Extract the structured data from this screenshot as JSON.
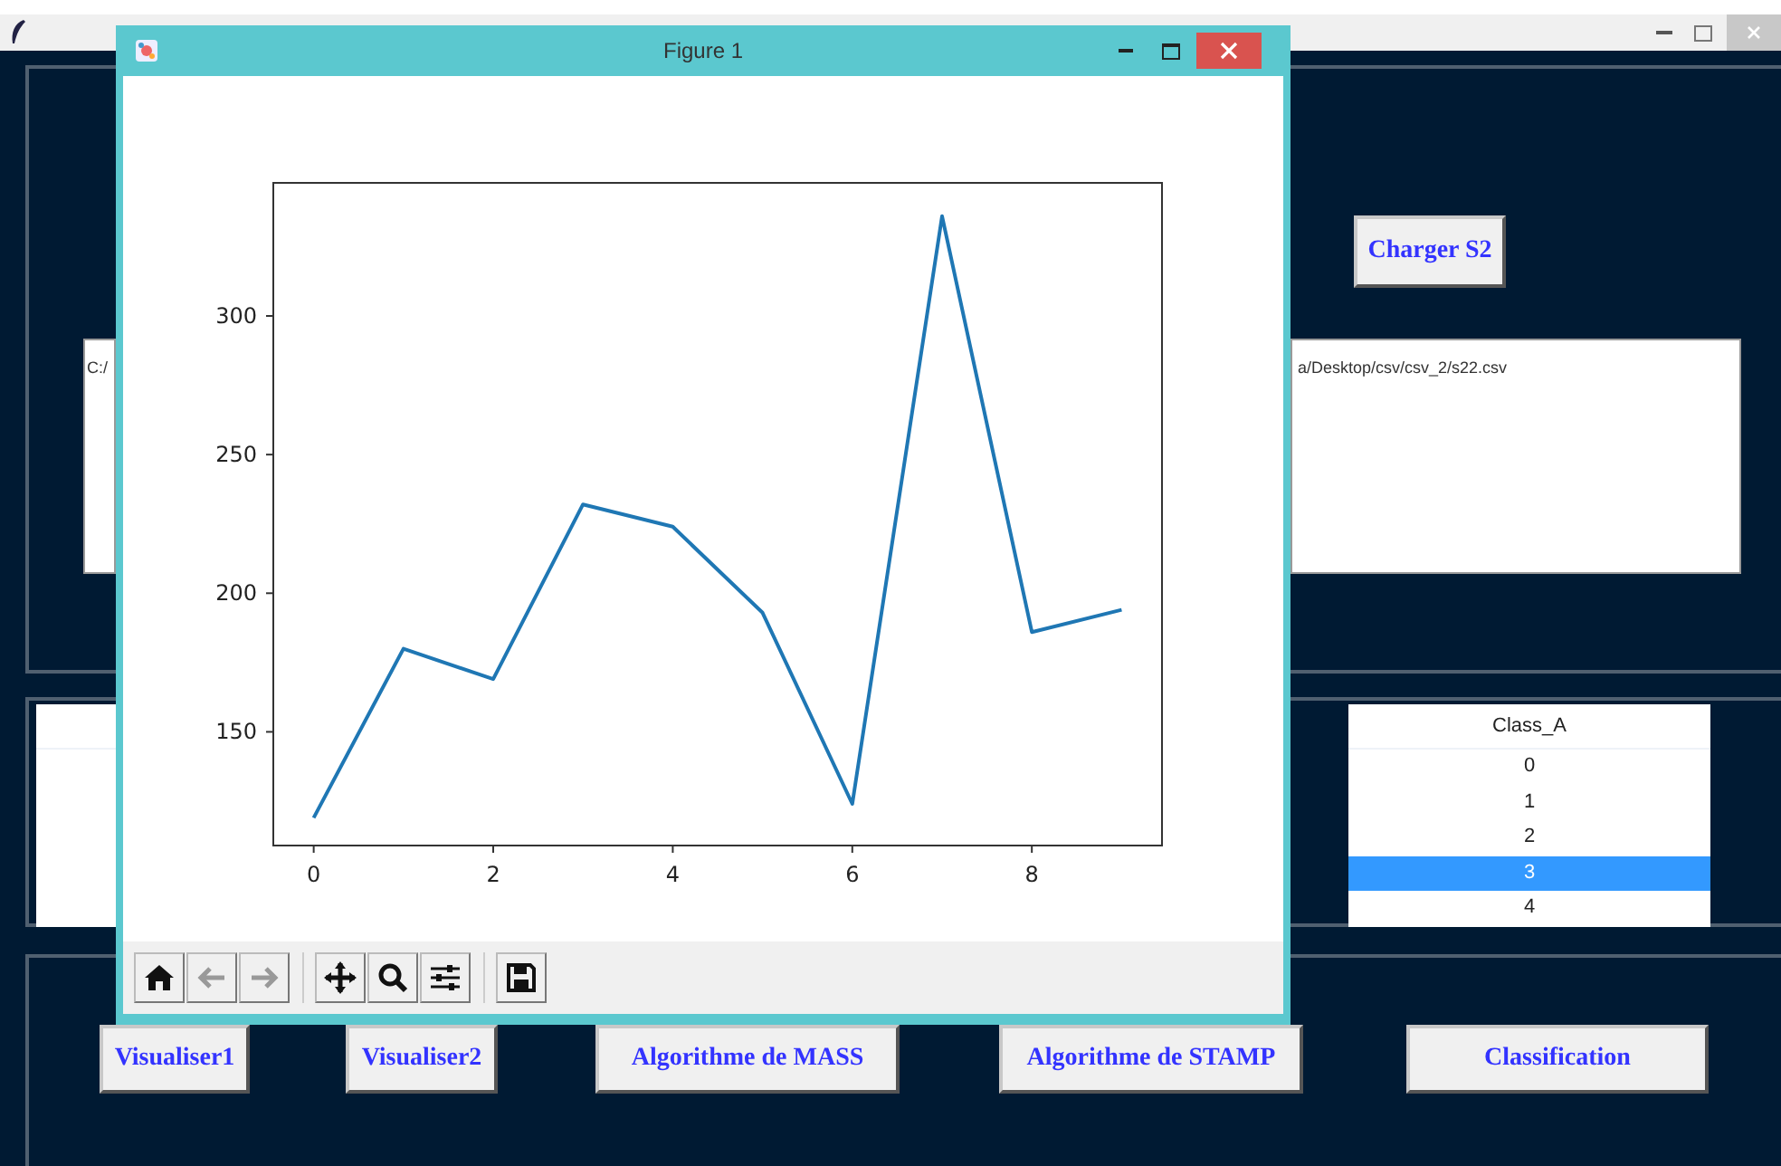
{
  "main_window": {
    "load_button": "Charger S2",
    "path_boxes": [
      "C:/",
      "a/Desktop/csv/csv_2/s22.csv"
    ],
    "class_table": {
      "column": "Class_A",
      "rows": [
        {
          "value": "0",
          "selected": false
        },
        {
          "value": "1",
          "selected": false
        },
        {
          "value": "2",
          "selected": false
        },
        {
          "value": "3",
          "selected": true
        },
        {
          "value": "4",
          "selected": false
        }
      ]
    },
    "buttons": [
      "Visualiser1",
      "Visualiser2",
      "Algorithme de MASS",
      "Algorithme de STAMP",
      "Classification"
    ]
  },
  "figure_window": {
    "title": "Figure 1",
    "chart_data": {
      "type": "line",
      "x": [
        0,
        1,
        2,
        3,
        4,
        5,
        6,
        7,
        8,
        9
      ],
      "series": [
        {
          "color": "#1f77b4",
          "values": [
            119,
            180,
            169,
            232,
            224,
            193,
            124,
            336,
            186,
            194
          ]
        }
      ],
      "xlim": [
        -0.45,
        9.45
      ],
      "ylim": [
        109,
        348
      ],
      "xticks": [
        0,
        2,
        4,
        6,
        8
      ],
      "yticks": [
        150,
        200,
        250,
        300
      ]
    },
    "toolbar": [
      {
        "disabled": false
      },
      {
        "disabled": true
      },
      {
        "disabled": true
      },
      {
        "disabled": false
      },
      {
        "disabled": false
      },
      {
        "disabled": false
      },
      {
        "disabled": false
      }
    ]
  }
}
